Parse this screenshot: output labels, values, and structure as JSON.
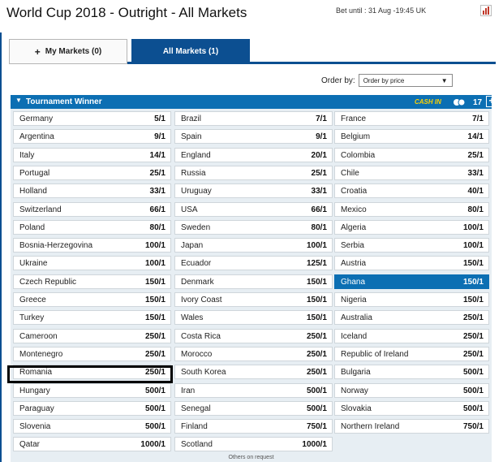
{
  "header": {
    "title": "World Cup 2018 - Outright - All Markets",
    "bet_until": "Bet until : 31 Aug -19:45 UK"
  },
  "tabs": {
    "my_markets": "My Markets (0)",
    "all_markets": "All Markets (1)"
  },
  "order": {
    "label": "Order by:",
    "selected": "Order by price"
  },
  "market": {
    "title": "Tournament Winner",
    "cash_in": "CASH IN",
    "count": "17",
    "expand": "+"
  },
  "columns": [
    [
      {
        "team": "Germany",
        "odds": "5/1"
      },
      {
        "team": "Argentina",
        "odds": "9/1"
      },
      {
        "team": "Italy",
        "odds": "14/1"
      },
      {
        "team": "Portugal",
        "odds": "25/1"
      },
      {
        "team": "Holland",
        "odds": "33/1"
      },
      {
        "team": "Switzerland",
        "odds": "66/1"
      },
      {
        "team": "Poland",
        "odds": "80/1"
      },
      {
        "team": "Bosnia-Herzegovina",
        "odds": "100/1"
      },
      {
        "team": "Ukraine",
        "odds": "100/1"
      },
      {
        "team": "Czech Republic",
        "odds": "150/1"
      },
      {
        "team": "Greece",
        "odds": "150/1"
      },
      {
        "team": "Turkey",
        "odds": "150/1"
      },
      {
        "team": "Cameroon",
        "odds": "250/1"
      },
      {
        "team": "Montenegro",
        "odds": "250/1"
      },
      {
        "team": "Romania",
        "odds": "250/1"
      },
      {
        "team": "Hungary",
        "odds": "500/1"
      },
      {
        "team": "Paraguay",
        "odds": "500/1"
      },
      {
        "team": "Slovenia",
        "odds": "500/1"
      },
      {
        "team": "Qatar",
        "odds": "1000/1"
      }
    ],
    [
      {
        "team": "Brazil",
        "odds": "7/1"
      },
      {
        "team": "Spain",
        "odds": "9/1"
      },
      {
        "team": "England",
        "odds": "20/1"
      },
      {
        "team": "Russia",
        "odds": "25/1"
      },
      {
        "team": "Uruguay",
        "odds": "33/1"
      },
      {
        "team": "USA",
        "odds": "66/1"
      },
      {
        "team": "Sweden",
        "odds": "80/1"
      },
      {
        "team": "Japan",
        "odds": "100/1"
      },
      {
        "team": "Ecuador",
        "odds": "125/1"
      },
      {
        "team": "Denmark",
        "odds": "150/1"
      },
      {
        "team": "Ivory Coast",
        "odds": "150/1"
      },
      {
        "team": "Wales",
        "odds": "150/1"
      },
      {
        "team": "Costa Rica",
        "odds": "250/1"
      },
      {
        "team": "Morocco",
        "odds": "250/1"
      },
      {
        "team": "South Korea",
        "odds": "250/1"
      },
      {
        "team": "Iran",
        "odds": "500/1"
      },
      {
        "team": "Senegal",
        "odds": "500/1"
      },
      {
        "team": "Finland",
        "odds": "750/1"
      },
      {
        "team": "Scotland",
        "odds": "1000/1"
      }
    ],
    [
      {
        "team": "France",
        "odds": "7/1"
      },
      {
        "team": "Belgium",
        "odds": "14/1"
      },
      {
        "team": "Colombia",
        "odds": "25/1"
      },
      {
        "team": "Chile",
        "odds": "33/1"
      },
      {
        "team": "Croatia",
        "odds": "40/1"
      },
      {
        "team": "Mexico",
        "odds": "80/1"
      },
      {
        "team": "Algeria",
        "odds": "100/1"
      },
      {
        "team": "Serbia",
        "odds": "100/1"
      },
      {
        "team": "Austria",
        "odds": "150/1"
      },
      {
        "team": "Ghana",
        "odds": "150/1"
      },
      {
        "team": "Nigeria",
        "odds": "150/1"
      },
      {
        "team": "Australia",
        "odds": "250/1"
      },
      {
        "team": "Iceland",
        "odds": "250/1"
      },
      {
        "team": "Republic of Ireland",
        "odds": "250/1"
      },
      {
        "team": "Bulgaria",
        "odds": "500/1"
      },
      {
        "team": "Norway",
        "odds": "500/1"
      },
      {
        "team": "Slovakia",
        "odds": "500/1"
      },
      {
        "team": "Northern Ireland",
        "odds": "750/1"
      }
    ]
  ],
  "selected_team": "Ghana",
  "outlined_team": "Romania",
  "footer": "Others on request",
  "colors": {
    "header_blue": "#0c6fb3",
    "tab_blue": "#0c4f91",
    "cash_in_yellow": "#ffd200"
  },
  "icons": {
    "chart": "bar-chart-icon",
    "cash_in": "cash-in-icon",
    "expand": "plus-box-icon",
    "collapse": "triangle-down-icon"
  }
}
